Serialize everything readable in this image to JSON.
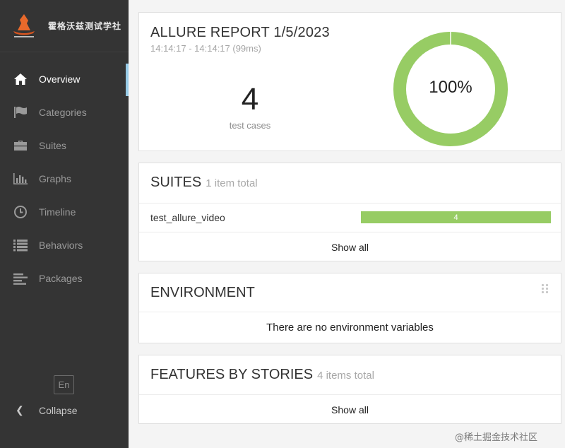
{
  "brand": {
    "name": "霍格沃兹测试学社",
    "logo_icon": "wizard-hat-icon"
  },
  "nav": {
    "items": [
      {
        "label": "Overview",
        "icon": "home-icon",
        "active": true
      },
      {
        "label": "Categories",
        "icon": "flag-icon",
        "active": false
      },
      {
        "label": "Suites",
        "icon": "briefcase-icon",
        "active": false
      },
      {
        "label": "Graphs",
        "icon": "bar-chart-icon",
        "active": false
      },
      {
        "label": "Timeline",
        "icon": "clock-icon",
        "active": false
      },
      {
        "label": "Behaviors",
        "icon": "list-icon",
        "active": false
      },
      {
        "label": "Packages",
        "icon": "align-left-icon",
        "active": false
      }
    ],
    "language": "En",
    "collapse_label": "Collapse"
  },
  "summary": {
    "title": "ALLURE REPORT 1/5/2023",
    "time_range": "14:14:17 - 14:14:17 (99ms)",
    "test_case_count": "4",
    "test_case_label": "test cases",
    "pass_rate": 100,
    "pass_rate_label": "100%"
  },
  "suites": {
    "title": "SUITES",
    "count_text": "1 item total",
    "items": [
      {
        "name": "test_allure_video",
        "passed": 4,
        "total": 4
      }
    ],
    "show_all": "Show all"
  },
  "environment": {
    "title": "ENVIRONMENT",
    "empty_text": "There are no environment variables"
  },
  "features": {
    "title": "FEATURES BY STORIES",
    "count_text": "4 items total",
    "show_all": "Show all"
  },
  "watermark": "@稀土掘金技术社区",
  "colors": {
    "sidebar_bg": "#343434",
    "passed": "#97cc64",
    "active_marker": "#97cbe7"
  }
}
